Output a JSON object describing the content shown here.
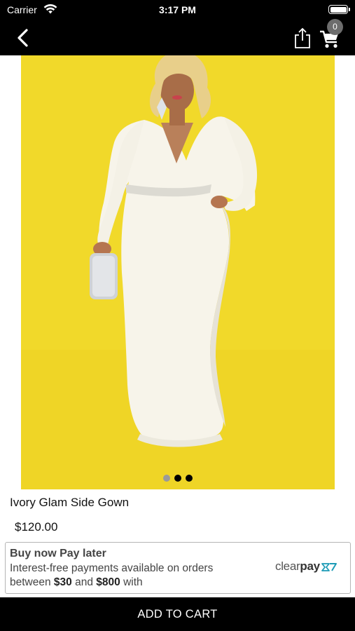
{
  "status_bar": {
    "carrier": "Carrier",
    "time": "3:17 PM",
    "wifi_icon": "wifi-icon",
    "battery_icon": "battery-icon"
  },
  "nav": {
    "back_icon": "chevron-left-icon",
    "share_icon": "share-icon",
    "cart_icon": "cart-icon",
    "cart_count": "0"
  },
  "gallery": {
    "image_subject": "product-photo",
    "page_count": 3,
    "active_page": 2
  },
  "product": {
    "name": "Ivory Glam Side Gown",
    "price": "$120.00"
  },
  "pay_later": {
    "title": "Buy now Pay later",
    "line1": "Interest-free payments available on orders",
    "line2_prefix": "between ",
    "min_amount": "$30",
    "line2_mid": " and ",
    "max_amount": "$800",
    "line2_suffix": " with",
    "provider_light": "clear",
    "provider_bold": "pay",
    "provider_icon": "clearpay-logo-icon"
  },
  "actions": {
    "add_to_cart_label": "ADD TO CART"
  },
  "colors": {
    "bar_background": "#000000",
    "image_background": "#f1d92a",
    "badge": "#6d6d6d",
    "clearpay_accent": "#1d9bb6"
  }
}
